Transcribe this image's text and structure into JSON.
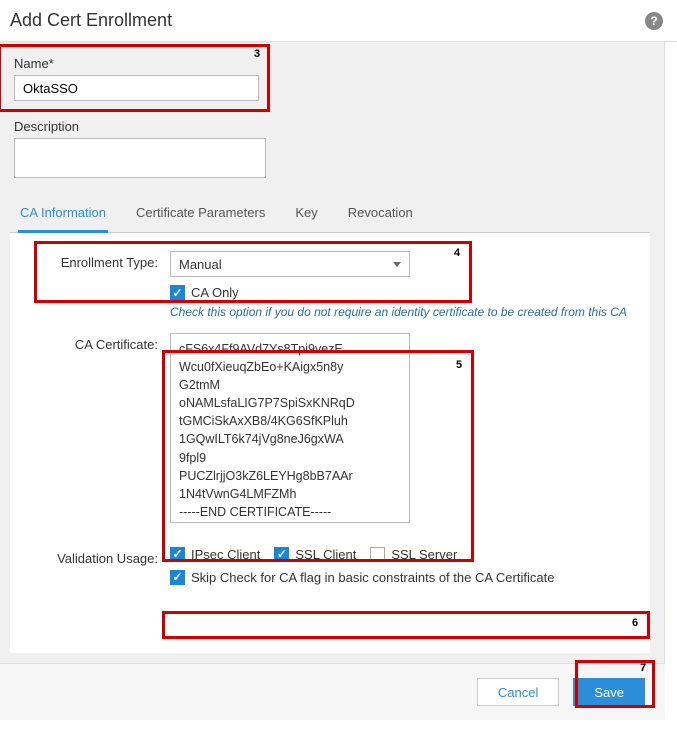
{
  "header": {
    "title": "Add Cert Enrollment",
    "help_icon": "?"
  },
  "fields": {
    "name_label": "Name*",
    "name_value": "OktaSSO",
    "description_label": "Description",
    "description_value": ""
  },
  "tabs": [
    {
      "label": "CA Information",
      "active": true
    },
    {
      "label": "Certificate Parameters",
      "active": false
    },
    {
      "label": "Key",
      "active": false
    },
    {
      "label": "Revocation",
      "active": false
    }
  ],
  "enrollment": {
    "label": "Enrollment Type:",
    "selected": "Manual",
    "ca_only_label": "CA Only",
    "ca_only_checked": true,
    "hint": "Check this option if you do not require an identity certificate to be created from this CA"
  },
  "ca_cert": {
    "label": "CA Certificate:",
    "value": "cFS6x4Ff9AVd7Ys8Tpi9vezE\nWcu0fXieuqZbEo+KAigx5n8y\nG2tmM\noNAMLsfaLIG7P7SpiSxKNRqD\ntGMCiSkAxXB8/4KG6SfKPluh\n1GQwILT6k74jVg8neJ6gxWA\n9fpl9\nPUCZlrjjO3kZ6LEYHg8bB7AAr\n1N4tVwnG4LMFZMh\n-----END CERTIFICATE-----"
  },
  "validation": {
    "label": "Validation Usage:",
    "ipsec_label": "IPsec Client",
    "ipsec_checked": true,
    "sslclient_label": "SSL Client",
    "sslclient_checked": true,
    "sslserver_label": "SSL Server",
    "sslserver_checked": false,
    "skip_label": "Skip Check for CA flag in basic constraints of the CA Certificate",
    "skip_checked": true
  },
  "footer": {
    "cancel": "Cancel",
    "save": "Save"
  },
  "callouts": {
    "c3": "3",
    "c4": "4",
    "c5": "5",
    "c6": "6",
    "c7": "7"
  }
}
